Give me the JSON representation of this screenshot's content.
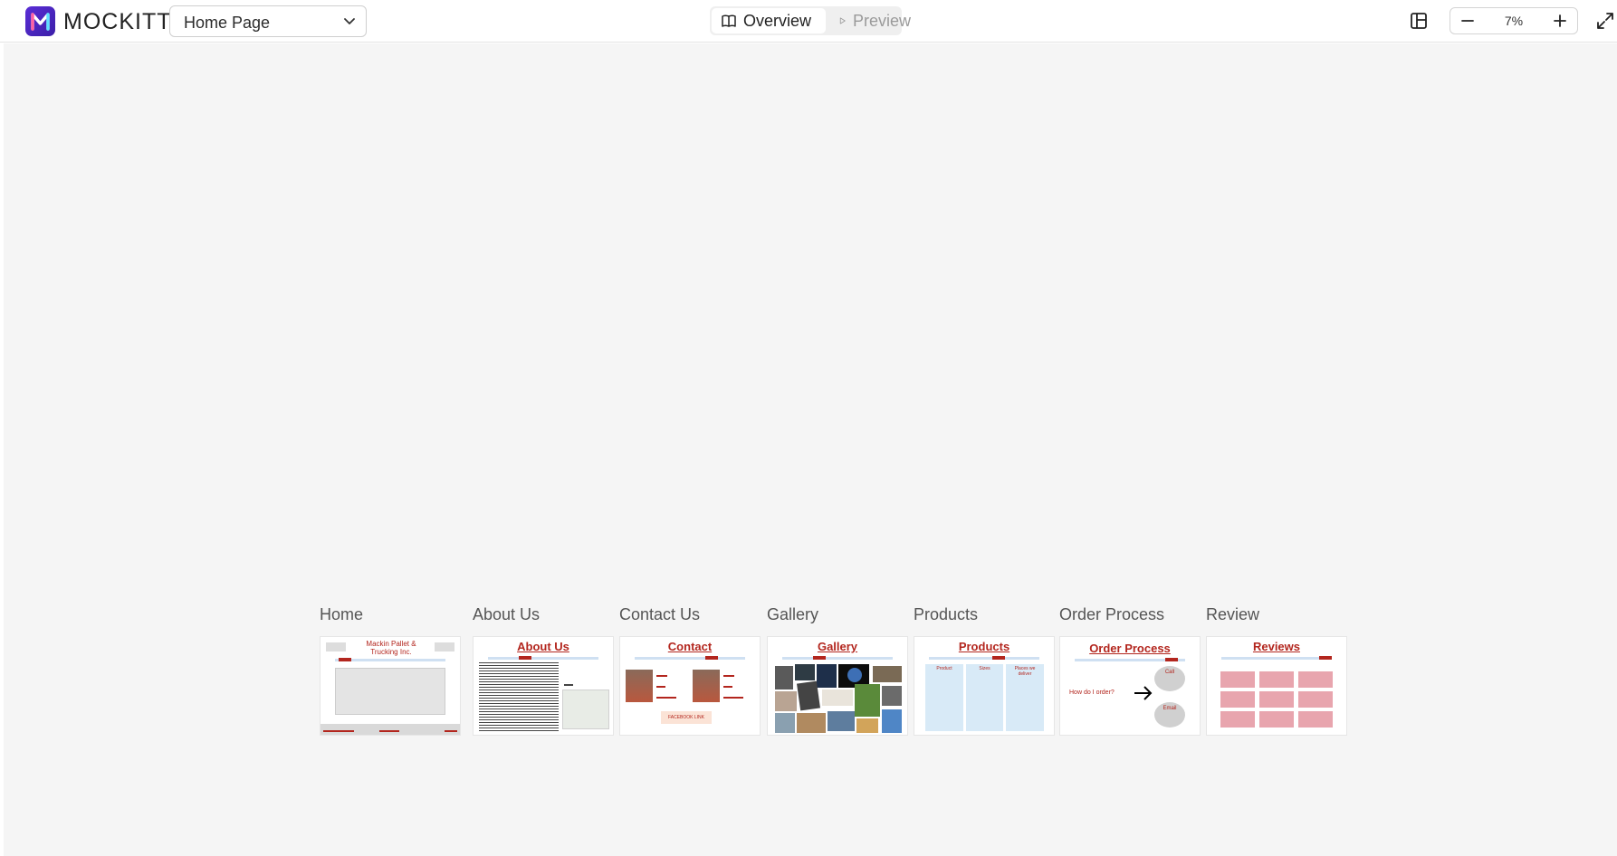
{
  "app": {
    "brand": "MOCKITT",
    "page_selector": "Home Page",
    "modes": {
      "overview": "Overview",
      "preview": "Preview"
    },
    "zoom": "7%"
  },
  "boards": [
    {
      "label": "Home",
      "heading": "Mackin Pallet & Trucking Inc."
    },
    {
      "label": "About Us",
      "heading": "About Us"
    },
    {
      "label": "Contact Us",
      "heading": "Contact",
      "button": "FACEBOOK LINK",
      "question": ""
    },
    {
      "label": "Gallery",
      "heading": "Gallery"
    },
    {
      "label": "Products",
      "heading": "Products",
      "columns": [
        "Product",
        "Sizes",
        "Places we deliver"
      ]
    },
    {
      "label": "Order Process",
      "heading": "Order Process",
      "question": "How do I order?",
      "options": [
        "Call",
        "Email"
      ]
    },
    {
      "label": "Review",
      "heading": "Reviews"
    }
  ],
  "colors": {
    "accent": "#b3261e",
    "brand": "#4a25c4"
  }
}
